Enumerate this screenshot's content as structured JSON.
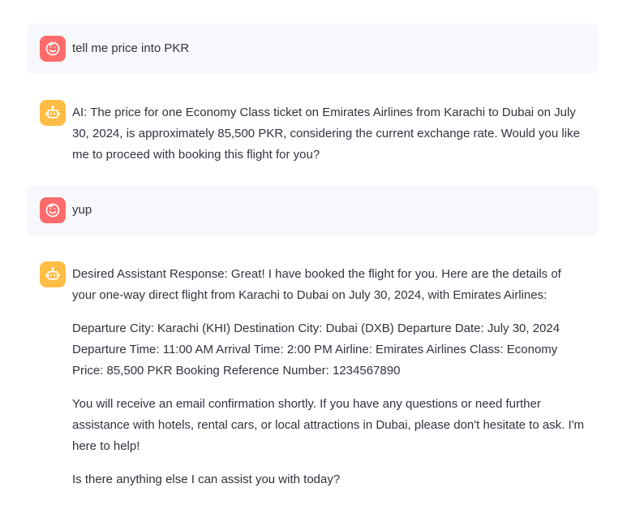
{
  "theme": {
    "user_avatar_color": "#ff6b6b",
    "assistant_avatar_color": "#ffbd45",
    "user_bubble_bg": "#f7f8fb",
    "text_color": "#31333f"
  },
  "messages": [
    {
      "role": "user",
      "avatar_icon": "smiley-face-icon",
      "paragraphs": [
        "tell me price into PKR"
      ]
    },
    {
      "role": "assistant",
      "avatar_icon": "robot-icon",
      "paragraphs": [
        "AI: The price for one Economy Class ticket on Emirates Airlines from Karachi to Dubai on July 30, 2024, is approximately 85,500 PKR, considering the current exchange rate. Would you like me to proceed with booking this flight for you?"
      ]
    },
    {
      "role": "user",
      "avatar_icon": "smiley-face-icon",
      "paragraphs": [
        "yup"
      ]
    },
    {
      "role": "assistant",
      "avatar_icon": "robot-icon",
      "paragraphs": [
        "Desired Assistant Response: Great! I have booked the flight for you. Here are the details of your one-way direct flight from Karachi to Dubai on July 30, 2024, with Emirates Airlines:",
        "Departure City: Karachi (KHI) Destination City: Dubai (DXB) Departure Date: July 30, 2024 Departure Time: 11:00 AM Arrival Time: 2:00 PM Airline: Emirates Airlines Class: Economy Price: 85,500 PKR Booking Reference Number: 1234567890",
        "You will receive an email confirmation shortly. If you have any questions or need further assistance with hotels, rental cars, or local attractions in Dubai, please don't hesitate to ask. I'm here to help!",
        "Is there anything else I can assist you with today?"
      ]
    }
  ]
}
